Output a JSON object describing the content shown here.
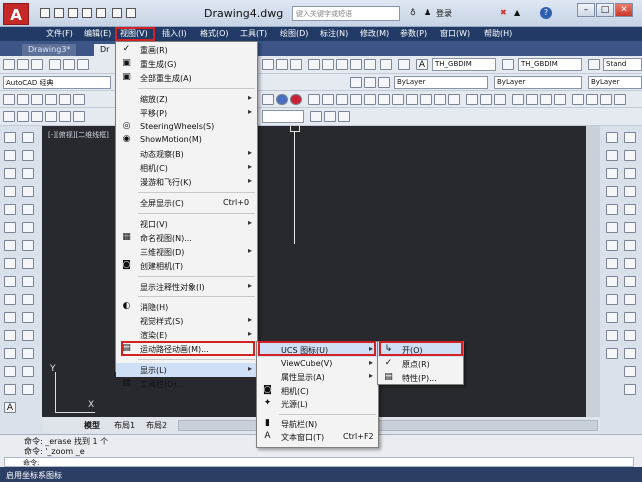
{
  "app": {
    "logo": "A",
    "document_title": "Drawing4.dwg",
    "search_placeholder": "键入关键字或短语",
    "login": "登录",
    "help_glyph": "?"
  },
  "menubar": [
    "文件(F)",
    "编辑(E)",
    "视图(V)",
    "插入(I)",
    "格式(O)",
    "工具(T)",
    "绘图(D)",
    "标注(N)",
    "修改(M)",
    "参数(P)",
    "窗口(W)",
    "帮助(H)"
  ],
  "doc_tabs": [
    "Drawing3*",
    "Dr"
  ],
  "toolbar": {
    "workspace": "AutoCAD 经典",
    "layer": "ByLayer",
    "linetype": "ByLayer",
    "color": "ByLayer",
    "style1": "TH_GBDIM",
    "style2": "TH_GBDIM",
    "style3": "Stand"
  },
  "viewport_label": "[-][俯视][二维线框]",
  "view_menu": {
    "items": [
      {
        "label": "重画(R)",
        "icon": "✓"
      },
      {
        "label": "重生成(G)",
        "icon": "▣"
      },
      {
        "label": "全部重生成(A)",
        "icon": "▣"
      },
      {
        "sep": true
      },
      {
        "label": "缩放(Z)",
        "sub": true
      },
      {
        "label": "平移(P)",
        "sub": true
      },
      {
        "label": "SteeringWheels(S)",
        "icon": "◎"
      },
      {
        "label": "ShowMotion(M)",
        "icon": "◉"
      },
      {
        "label": "动态观察(B)",
        "sub": true
      },
      {
        "label": "相机(C)",
        "sub": true
      },
      {
        "label": "漫游和飞行(K)",
        "sub": true
      },
      {
        "sep": true
      },
      {
        "label": "全屏显示(C)",
        "shortcut": "Ctrl+0"
      },
      {
        "sep": true
      },
      {
        "label": "视口(V)",
        "sub": true
      },
      {
        "label": "命名视图(N)...",
        "icon": "▦"
      },
      {
        "label": "三维视图(D)",
        "sub": true
      },
      {
        "label": "创建相机(T)",
        "icon": "◙"
      },
      {
        "sep": true
      },
      {
        "label": "显示注释性对象(I)",
        "sub": true
      },
      {
        "sep": true
      },
      {
        "label": "消隐(H)",
        "icon": "◐"
      },
      {
        "label": "视觉样式(S)",
        "sub": true
      },
      {
        "label": "渲染(E)",
        "sub": true
      },
      {
        "label": "运动路径动画(M)...",
        "icon": "▤"
      },
      {
        "sep": true
      },
      {
        "label": "显示(L)",
        "sub": true
      },
      {
        "label": "工具栏(O)...",
        "icon": "▥"
      }
    ]
  },
  "display_menu": {
    "items": [
      {
        "label": "UCS 图标(U)",
        "sub": true
      },
      {
        "label": "ViewCube(V)",
        "sub": true
      },
      {
        "label": "属性显示(A)",
        "sub": true
      },
      {
        "label": "相机(C)",
        "icon": "◙"
      },
      {
        "label": "光源(L)",
        "icon": "✦"
      },
      {
        "sep": true
      },
      {
        "label": "导航栏(N)",
        "icon": "▮"
      },
      {
        "label": "文本窗口(T)",
        "icon": "A",
        "shortcut": "Ctrl+F2"
      }
    ]
  },
  "ucs_menu": {
    "items": [
      {
        "label": "开(O)",
        "icon": "↳"
      },
      {
        "label": "原点(R)",
        "icon": "✓"
      },
      {
        "label": "特性(P)...",
        "icon": "▤"
      }
    ]
  },
  "layout_tabs": [
    "模型",
    "布局1",
    "布局2"
  ],
  "command": {
    "line1": "命令: _erase 找到 1 个",
    "line2": "命令: '_zoom _e",
    "prompt": "命令: "
  },
  "status_text": "启用坐标系图标",
  "colors": {
    "accent": "#d32020",
    "menubar": "#223b66",
    "drawing": "#28292e"
  }
}
